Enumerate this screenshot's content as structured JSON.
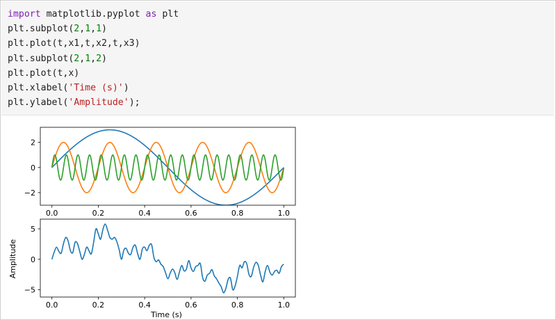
{
  "code_lines": [
    [
      {
        "t": "import",
        "c": "kw"
      },
      {
        "t": " matplotlib.pyplot ",
        "c": ""
      },
      {
        "t": "as",
        "c": "kw"
      },
      {
        "t": " plt",
        "c": ""
      }
    ],
    [
      {
        "t": "plt.subplot(",
        "c": ""
      },
      {
        "t": "2",
        "c": "num"
      },
      {
        "t": ",",
        "c": ""
      },
      {
        "t": "1",
        "c": "num"
      },
      {
        "t": ",",
        "c": ""
      },
      {
        "t": "1",
        "c": "num"
      },
      {
        "t": ")",
        "c": ""
      }
    ],
    [
      {
        "t": "plt.plot(t,x1,t,x2,t,x3)",
        "c": ""
      }
    ],
    [
      {
        "t": "plt.subplot(",
        "c": ""
      },
      {
        "t": "2",
        "c": "num"
      },
      {
        "t": ",",
        "c": ""
      },
      {
        "t": "1",
        "c": "num"
      },
      {
        "t": ",",
        "c": ""
      },
      {
        "t": "2",
        "c": "num"
      },
      {
        "t": ")",
        "c": ""
      }
    ],
    [
      {
        "t": "plt.plot(t,x)",
        "c": ""
      }
    ],
    [
      {
        "t": "plt.xlabel(",
        "c": ""
      },
      {
        "t": "'Time (s)'",
        "c": "str"
      },
      {
        "t": ")",
        "c": ""
      }
    ],
    [
      {
        "t": "plt.ylabel(",
        "c": ""
      },
      {
        "t": "'Amplitude'",
        "c": "str"
      },
      {
        "t": ");",
        "c": ""
      }
    ]
  ],
  "colors": {
    "blue": "#1f77b4",
    "orange": "#ff7f0e",
    "green": "#2ca02c"
  },
  "chart_data": [
    {
      "type": "line",
      "title": "",
      "xlabel": "",
      "ylabel": "",
      "xlim": [
        -0.05,
        1.05
      ],
      "ylim": [
        -3.0,
        3.2
      ],
      "xticks": [
        "0.0",
        "0.2",
        "0.4",
        "0.6",
        "0.8",
        "1.0"
      ],
      "yticks": [
        "2",
        "0",
        "−2"
      ],
      "ytick_values": [
        2,
        0,
        -2
      ],
      "series": [
        {
          "color": "blue",
          "amplitude": 3,
          "frequency_hz": 1
        },
        {
          "color": "orange",
          "amplitude": 2,
          "frequency_hz": 5
        },
        {
          "color": "green",
          "amplitude": 1,
          "frequency_hz": 20
        }
      ]
    },
    {
      "type": "line",
      "title": "",
      "xlabel": "Time (s)",
      "ylabel": "Amplitude",
      "xlim": [
        -0.05,
        1.05
      ],
      "ylim": [
        -6.2,
        6.6
      ],
      "xticks": [
        "0.0",
        "0.2",
        "0.4",
        "0.6",
        "0.8",
        "1.0"
      ],
      "yticks": [
        "5",
        "0",
        "−5"
      ],
      "ytick_values": [
        5,
        0,
        -5
      ],
      "series": [
        {
          "color": "blue",
          "x": [
            0.0,
            0.01,
            0.02,
            0.03,
            0.04,
            0.05,
            0.06,
            0.07,
            0.08,
            0.09,
            0.1,
            0.11,
            0.12,
            0.13,
            0.14,
            0.15,
            0.16,
            0.17,
            0.18,
            0.19,
            0.2,
            0.21,
            0.22,
            0.23,
            0.24,
            0.25,
            0.26,
            0.27,
            0.28,
            0.29,
            0.3,
            0.31,
            0.32,
            0.33,
            0.34,
            0.35,
            0.36,
            0.37,
            0.38,
            0.39,
            0.4,
            0.41,
            0.42,
            0.43,
            0.44,
            0.45,
            0.46,
            0.47,
            0.48,
            0.49,
            0.5,
            0.51,
            0.52,
            0.53,
            0.54,
            0.55,
            0.56,
            0.57,
            0.58,
            0.59,
            0.6,
            0.61,
            0.62,
            0.63,
            0.64,
            0.65,
            0.66,
            0.67,
            0.68,
            0.69,
            0.7,
            0.71,
            0.72,
            0.73,
            0.74,
            0.75,
            0.76,
            0.77,
            0.78,
            0.79,
            0.8,
            0.81,
            0.82,
            0.83,
            0.84,
            0.85,
            0.86,
            0.87,
            0.88,
            0.89,
            0.9,
            0.91,
            0.92,
            0.93,
            0.94,
            0.95,
            0.96,
            0.97,
            0.98,
            0.99,
            1.0
          ],
          "y": [
            0.0,
            1.2,
            2.0,
            1.3,
            1.0,
            2.6,
            3.6,
            3.0,
            1.4,
            1.1,
            2.8,
            2.6,
            1.3,
            0.0,
            0.8,
            2.0,
            1.4,
            0.9,
            2.8,
            5.0,
            4.2,
            3.3,
            4.9,
            5.8,
            4.8,
            3.6,
            3.3,
            3.6,
            2.9,
            1.6,
            0.0,
            1.5,
            1.8,
            1.0,
            0.8,
            2.0,
            2.3,
            0.9,
            0.0,
            1.7,
            2.0,
            1.4,
            2.3,
            2.4,
            0.3,
            -0.4,
            -0.1,
            -0.8,
            -1.2,
            -2.2,
            -3.2,
            -2.3,
            -1.6,
            -2.2,
            -3.3,
            -2.1,
            -1.0,
            -1.9,
            -1.6,
            -0.2,
            -1.4,
            -2.0,
            -1.2,
            -1.0,
            -0.7,
            -3.0,
            -3.6,
            -2.6,
            -2.3,
            -1.7,
            -2.7,
            -3.2,
            -3.9,
            -4.5,
            -5.5,
            -4.8,
            -3.3,
            -3.1,
            -5.0,
            -4.4,
            -2.8,
            -1.0,
            -1.4,
            -0.4,
            -0.7,
            -2.5,
            -2.8,
            -1.3,
            -0.5,
            -1.0,
            -2.6,
            -3.7,
            -2.0,
            -1.0,
            -2.1,
            -2.6,
            -2.0,
            -1.8,
            -2.3,
            -1.2,
            -0.8
          ]
        }
      ]
    }
  ]
}
